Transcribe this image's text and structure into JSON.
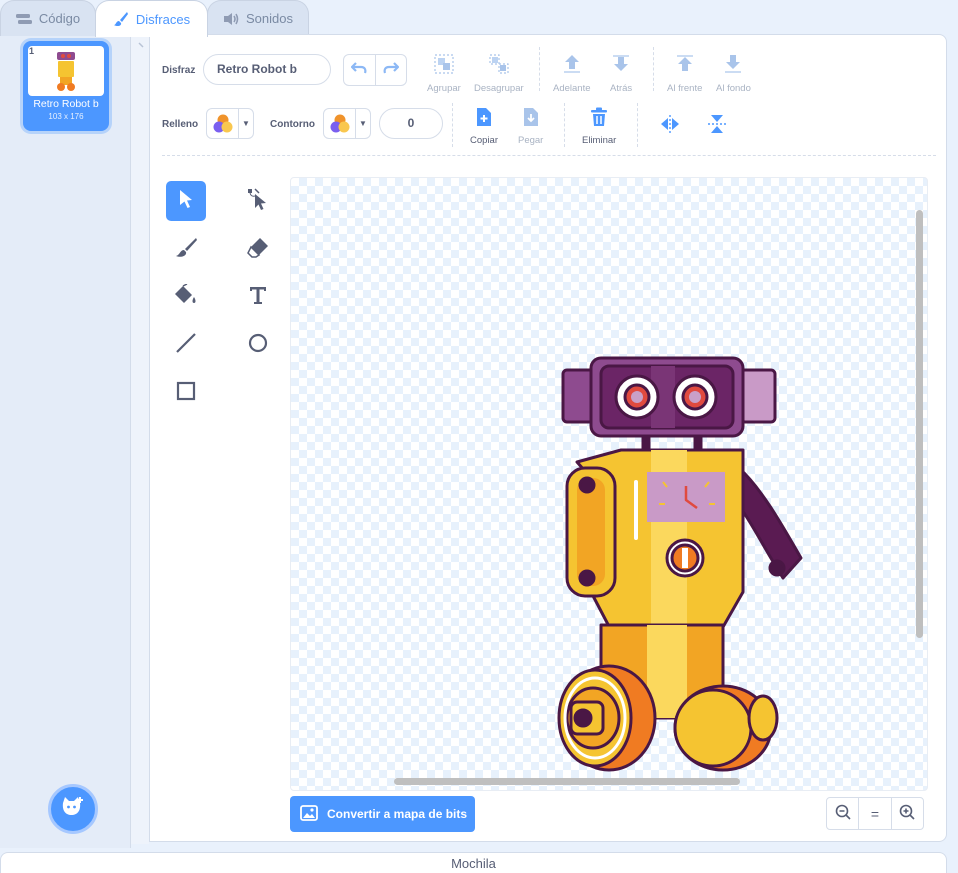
{
  "tabs": [
    {
      "label": "Código",
      "icon": "code-icon"
    },
    {
      "label": "Disfraces",
      "icon": "brush-icon",
      "active": true
    },
    {
      "label": "Sonidos",
      "icon": "speaker-icon"
    }
  ],
  "costume_list": {
    "items": [
      {
        "number": "1",
        "name": "Retro Robot b",
        "size": "103 x 176"
      }
    ],
    "add_button_icon": "cat-plus-icon"
  },
  "editor": {
    "costume_label": "Disfraz",
    "costume_name": "Retro Robot b",
    "fill_label": "Relleno",
    "outline_label": "Contorno",
    "outline_width": "0",
    "buttons": {
      "group": "Agrupar",
      "ungroup": "Desagrupar",
      "forward": "Adelante",
      "backward": "Atrás",
      "front": "Al frente",
      "back": "Al fondo",
      "copy": "Copiar",
      "paste": "Pegar",
      "delete": "Eliminar"
    },
    "tools": [
      "select",
      "reshape",
      "brush",
      "eraser",
      "fill",
      "text",
      "line",
      "circle",
      "rectangle"
    ],
    "selected_tool": "select",
    "convert_button": "Convertir a mapa de bits",
    "zoom_reset": "="
  },
  "backpack_label": "Mochila",
  "colors": {
    "accent": "#4c97ff",
    "text": "#575e75",
    "disabled": "#a9b3c3"
  }
}
